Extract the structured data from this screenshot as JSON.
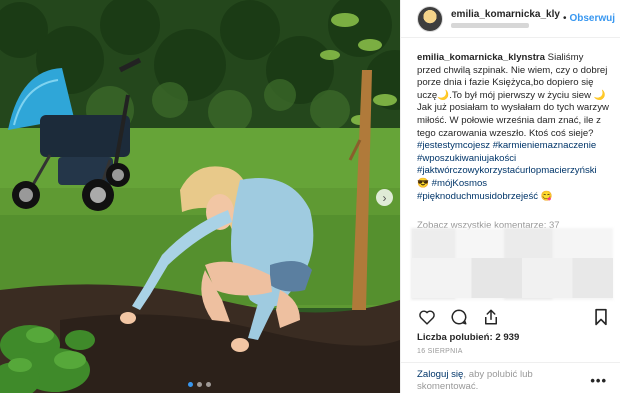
{
  "post": {
    "username": "emilia_komarnicka_kly",
    "separator": "•",
    "follow_label": "Obserwuj",
    "caption_user": "emilia_komarnicka_klynstra",
    "caption_text": " Sialiśmy przed chwilą szpinak. Nie wiem, czy o dobrej porze dnia i fazie Księżyca,bo dopiero się uczę🌙.To był mój pierwszy w życiu siew 🌙Jak już posiałam to wysłałam do tych warzyw miłość. W połowie września dam znać, ile z tego czarowania wzeszło. Ktoś coś sieje? ",
    "hashtags": [
      "#jestestymcojesz",
      "#karmieniemaznaczenie",
      "#wposzukiwaniujakości",
      "#jaktwórczowykorzystaćurlopmacierzyński"
    ],
    "emoji_1": "😎",
    "hashtags2": [
      "#mójKosmos",
      "#pięknoduchmusidobrzejeść"
    ],
    "emoji_2": "😋",
    "comments_link": "Zobacz wszystkie komentarze: 37",
    "likes": "Liczba polubień: 2 939",
    "date": "16 SIERPNIA",
    "login_link": "Zaloguj się",
    "login_rest": ", aby polubić lub skomentować.",
    "more": "•••",
    "next_arrow": "›"
  },
  "photo": {
    "carousel_count": 3,
    "carousel_active": 1
  },
  "icons": [
    "heart-icon",
    "comment-icon",
    "share-icon",
    "bookmark-icon",
    "chevron-right-icon"
  ]
}
